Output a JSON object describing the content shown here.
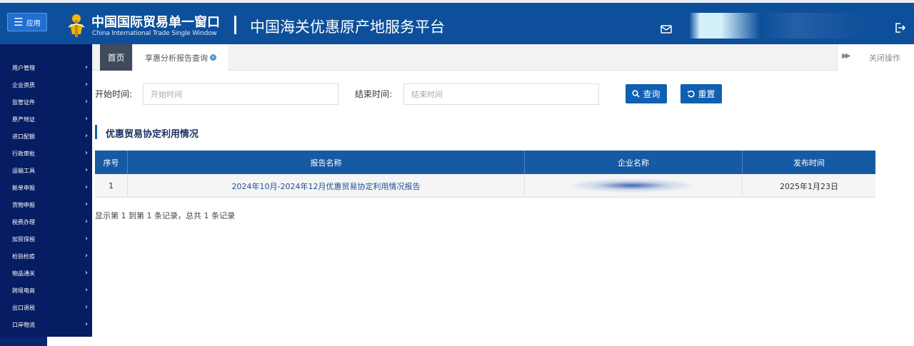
{
  "header": {
    "app_button_label": "应用",
    "brand_cn": "中国国际贸易单一窗口",
    "brand_en": "China International Trade Single Window",
    "platform_title": "中国海关优惠原产地服务平台"
  },
  "sidebar": {
    "items": [
      {
        "label": "用户管理"
      },
      {
        "label": "企业资质"
      },
      {
        "label": "监管证件"
      },
      {
        "label": "原产地证"
      },
      {
        "label": "进口配额"
      },
      {
        "label": "行政审批"
      },
      {
        "label": "运输工具"
      },
      {
        "label": "舱单申报"
      },
      {
        "label": "货物申报"
      },
      {
        "label": "税费办理"
      },
      {
        "label": "加贸保税"
      },
      {
        "label": "检验检疫"
      },
      {
        "label": "物品通关"
      },
      {
        "label": "跨境电商"
      },
      {
        "label": "出口退税"
      },
      {
        "label": "口岸物流"
      }
    ]
  },
  "tabs": {
    "home": "首页",
    "report": "享惠分析报告查询",
    "close_ops": "关闭操作"
  },
  "search": {
    "start_label": "开始时间:",
    "start_placeholder": "开始时间",
    "end_label": "结束时间:",
    "end_placeholder": "结束时间",
    "query_button": "查询",
    "reset_button": "重置"
  },
  "section": {
    "title": "优惠贸易协定利用情况"
  },
  "table": {
    "columns": [
      "序号",
      "报告名称",
      "企业名称",
      "发布时间"
    ],
    "rows": [
      {
        "index": "1",
        "report_name": "2024年10月-2024年12月优惠贸易协定利用情况报告",
        "company": "",
        "date": "2025年1月23日"
      }
    ]
  },
  "pagination": {
    "info": "显示第 1 到第 1 条记录，总共 1 条记录"
  },
  "colors": {
    "header_bg": "#0d4f9a",
    "sidebar_bg": "#061c63",
    "table_header_bg": "#155aa3",
    "button_bg": "#0f5fb3"
  }
}
